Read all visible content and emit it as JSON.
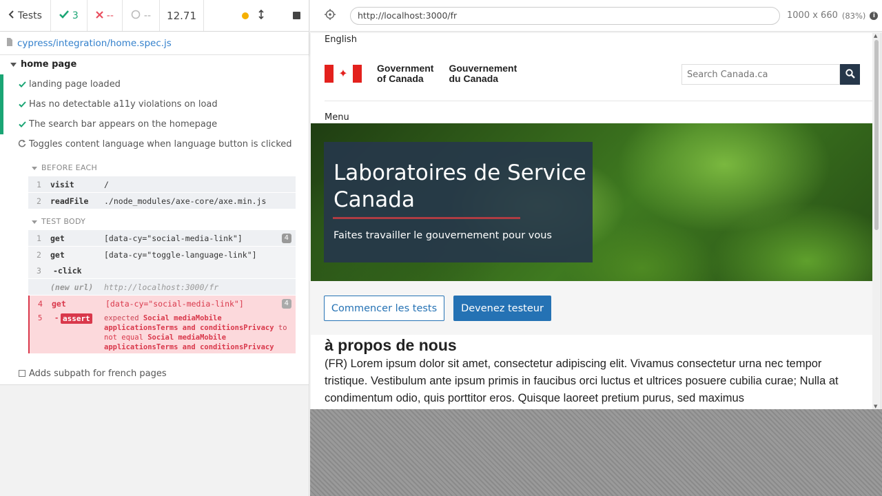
{
  "reporter": {
    "header": {
      "tests_label": "Tests",
      "passed": "3",
      "failed": "--",
      "pending": "--",
      "duration": "12.71"
    },
    "spec_path": "cypress/integration/home.spec.js",
    "suite_title": "home page",
    "tests": [
      {
        "title": "landing page loaded",
        "state": "passed"
      },
      {
        "title": "Has no detectable a11y violations on load",
        "state": "passed"
      },
      {
        "title": "The search bar appears on the homepage",
        "state": "passed"
      },
      {
        "title": "Toggles content language when language button is clicked",
        "state": "running"
      },
      {
        "title": "Adds subpath for french pages",
        "state": "pending"
      }
    ],
    "before_each": {
      "title": "BEFORE EACH",
      "commands": [
        {
          "num": "1",
          "name": "visit",
          "message": "/"
        },
        {
          "num": "2",
          "name": "readFile",
          "message": "./node_modules/axe-core/axe.min.js"
        }
      ]
    },
    "test_body": {
      "title": "TEST BODY",
      "commands": [
        {
          "num": "1",
          "name": "get",
          "message": "[data-cy=\"social-media-link\"]",
          "badge": "4"
        },
        {
          "num": "2",
          "name": "get",
          "message": "[data-cy=\"toggle-language-link\"]"
        },
        {
          "num": "3",
          "name": "-click",
          "message": ""
        },
        {
          "num": "",
          "name": "(new url)",
          "message": "http://localhost:3000/fr"
        },
        {
          "num": "4",
          "name": "get",
          "message": "[data-cy=\"social-media-link\"]",
          "badge": "4"
        }
      ],
      "assert": {
        "num": "5",
        "dash": "-",
        "tag": "assert",
        "expected_word": "expected",
        "value1_line1": "Social mediaMobile",
        "value1_line2": "applicationsTerms and conditionsPrivacy",
        "to_word": "to",
        "not_equal": "not equal",
        "value2_line1": "Social mediaMobile",
        "value2_line2": "applicationsTerms and conditionsPrivacy"
      }
    }
  },
  "aut": {
    "url": "http://localhost:3000/fr",
    "viewport": "1000 x 660",
    "scale": "(83%)",
    "page": {
      "language_link": "English",
      "goc_en_line1": "Government",
      "goc_en_line2": "of Canada",
      "goc_fr_line1": "Gouvernement",
      "goc_fr_line2": "du Canada",
      "search_placeholder": "Search Canada.ca",
      "menu": "Menu",
      "hero_title": "Laboratoires de Service Canada",
      "hero_subtitle": "Faites travailler le gouvernement pour vous",
      "btn_start": "Commencer les tests",
      "btn_become": "Devenez testeur",
      "about_heading": "à propos de nous",
      "about_text": "(FR) Lorem ipsum dolor sit amet, consectetur adipiscing elit. Vivamus consectetur urna nec tempor tristique. Vestibulum ante ipsum primis in faucibus orci luctus et ultrices posuere cubilia curae; Nulla at condimentum odio, quis porttitor eros. Quisque laoreet pretium purus, sed maximus"
    }
  },
  "colors": {
    "pass": "#1aa574",
    "fail": "#e94f5f",
    "link": "#3380cc",
    "canada_red": "#e3211d",
    "gc_blue": "#26374a",
    "button_blue": "#2572b4"
  }
}
